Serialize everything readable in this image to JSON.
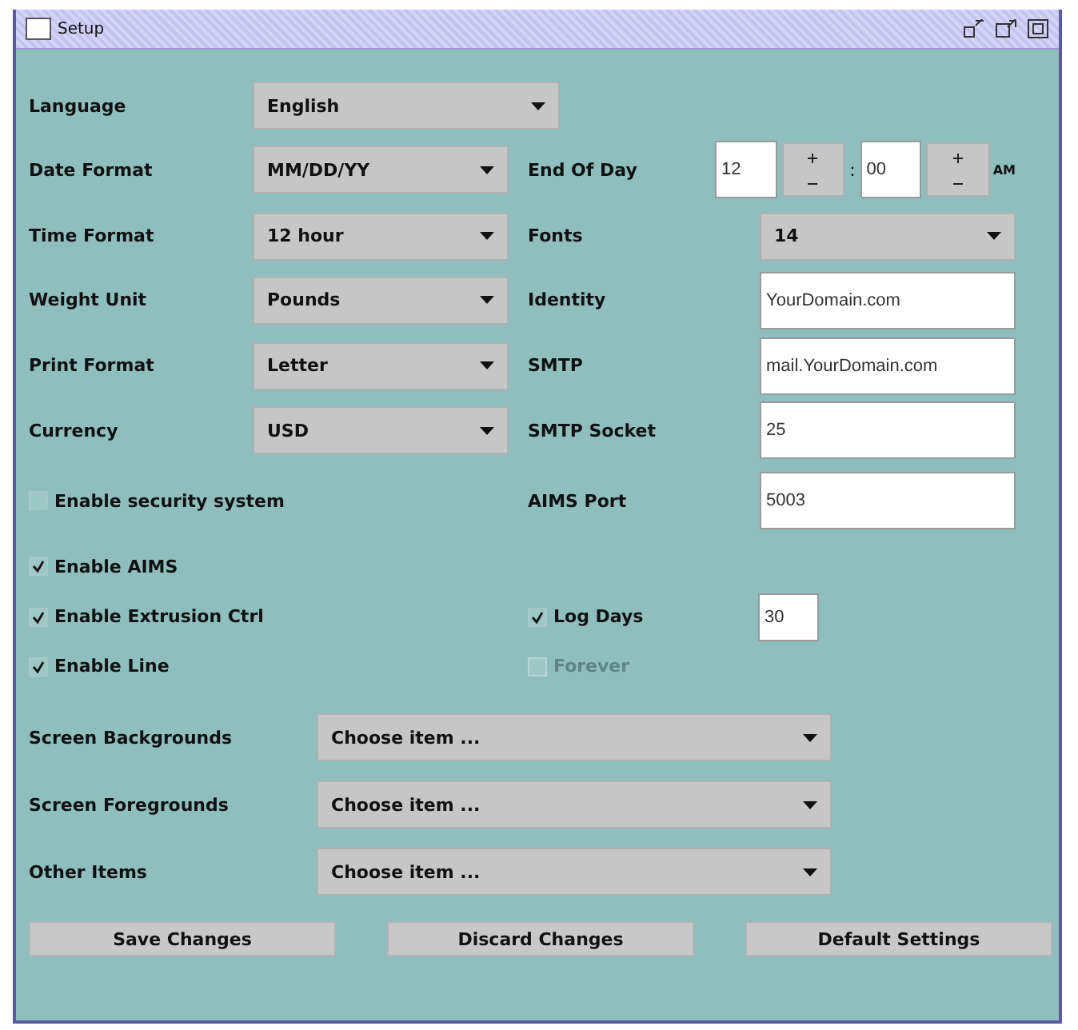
{
  "window": {
    "title": "Setup"
  },
  "settings": [
    {
      "label": "Language",
      "value": "English"
    },
    {
      "label": "Date Format",
      "value": "MM/DD/YY"
    },
    {
      "label": "Time Format",
      "value": "12 hour"
    },
    {
      "label": "Weight Unit",
      "value": "Pounds"
    },
    {
      "label": "Print Format",
      "value": "Letter"
    },
    {
      "label": "Currency",
      "value": "USD"
    }
  ],
  "end_of_day": {
    "label": "End Of Day",
    "hour": "12",
    "separator": ":",
    "minute": "00",
    "meridiem": "AM"
  },
  "right_fields": [
    {
      "kind": "dropdown",
      "label": "Fonts",
      "value": "14"
    },
    {
      "kind": "text",
      "label": "Identity",
      "value": "YourDomain.com"
    },
    {
      "kind": "text",
      "label": "SMTP",
      "value": "mail.YourDomain.com"
    },
    {
      "kind": "text",
      "label": "SMTP Socket",
      "value": "25"
    },
    {
      "kind": "text",
      "label": "AIMS Port",
      "value": "5003"
    }
  ],
  "options": [
    {
      "label": "Enable security system",
      "checked": false
    },
    {
      "label": "Enable AIMS",
      "checked": true
    },
    {
      "label": "Enable Extrusion Ctrl",
      "checked": true
    },
    {
      "label": "Enable Line",
      "checked": true
    }
  ],
  "log_days": {
    "label": "Log Days",
    "checked": true,
    "value": "30"
  },
  "forever": {
    "label": "Forever",
    "checked": false,
    "disabled": true
  },
  "item_lists": [
    {
      "label": "Screen Backgrounds",
      "value": "Choose item ..."
    },
    {
      "label": "Screen Foregrounds",
      "value": "Choose item ..."
    },
    {
      "label": "Other Items",
      "value": "Choose item ..."
    }
  ],
  "buttons": [
    "Save Changes",
    "Discard Changes",
    "Default Settings"
  ]
}
